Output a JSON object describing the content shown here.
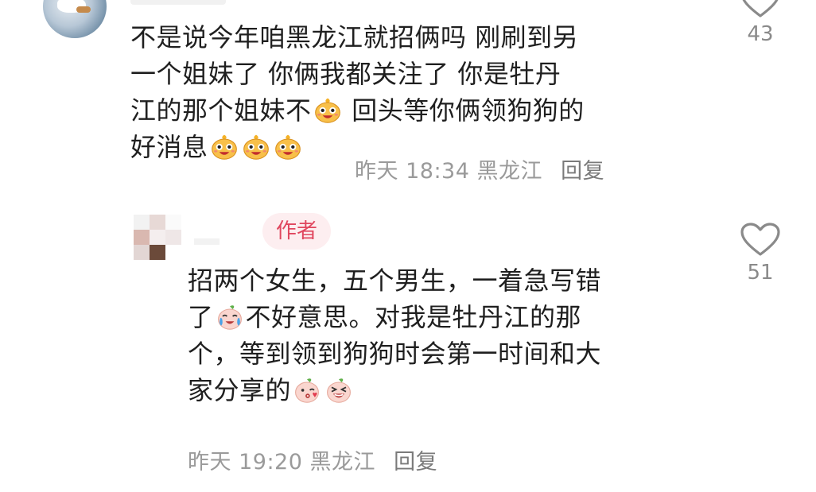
{
  "comments": [
    {
      "text_lines": [
        "不是说今年咱黑龙江就招俩吗  刚刷到另",
        "一个姐妹了  你俩我都关注了  你是牡丹",
        "江的那个姐妹不",
        "  回头等你俩领狗狗的",
        "好消息"
      ],
      "time": "昨天 18:34",
      "location": "黑龙江",
      "reply_label": "回复",
      "likes": "43"
    },
    {
      "badge": "作者",
      "text_lines": [
        "招两个女生，五个男生，一着急写错",
        "了",
        "不好意思。对我是牡丹江的那",
        "个，等到领到狗狗时会第一时间和大",
        "家分享的"
      ],
      "time": "昨天 19:20",
      "location": "黑龙江",
      "reply_label": "回复",
      "likes": "51"
    }
  ],
  "icons": {
    "like": "heart-outline-icon",
    "emoji_smile": "grinning-bun-emoji-icon",
    "emoji_tears": "laugh-cry-peach-emoji-icon",
    "emoji_kiss": "kiss-peach-emoji-icon",
    "emoji_laugh": "laugh-peach-emoji-icon"
  },
  "colors": {
    "badge_text": "#e0465e",
    "badge_bg": "#fdeef0",
    "meta_text": "#9a9a9a"
  }
}
